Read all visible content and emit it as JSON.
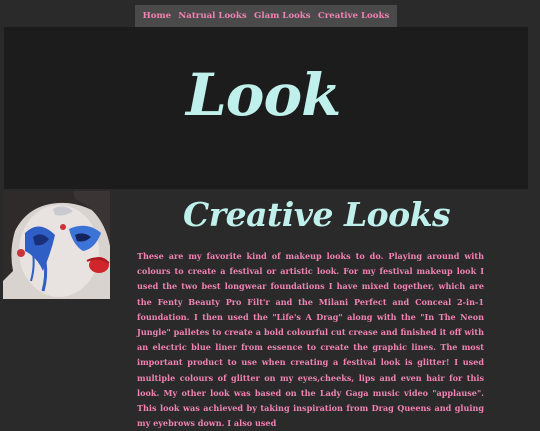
{
  "nav": {
    "items": [
      {
        "label": "Home"
      },
      {
        "label": "Natrual Looks"
      },
      {
        "label": "Glam Looks"
      },
      {
        "label": "Creative Looks"
      }
    ]
  },
  "hero": {
    "title": "Look"
  },
  "section": {
    "title": "Creative Looks",
    "body": "These are my favorite kind of makeup looks to do. Playing around with colours to create a festival or artistic look. For my festival makeup look I used the two best longwear foundations I have mixed together, which are the Fenty Beauty Pro Filt'r and the Milani Perfect and Conceal 2-in-1 foundation. I then used the \"Life's A Drag\" along with the \"In The Neon Jungle\" palletes to create a bold colourful cut crease and finished it off with an electric blue liner from essence to create the graphic lines. The most important product to use when creating a festival look is glitter! I used multiple colours of glitter on my eyes,cheeks, lips and even hair for this look. My other look was based on the Lady Gaga music video \"applause\". This look was achieved by taking inspiration from Drag Queens and gluing my eyebrows down. I also used"
  },
  "colors": {
    "pink": "#f083b3",
    "mint": "#bff0ec",
    "background": "#2a2a2a",
    "hero_background": "#1c1c1c",
    "nav_background": "#4a4a4a"
  }
}
